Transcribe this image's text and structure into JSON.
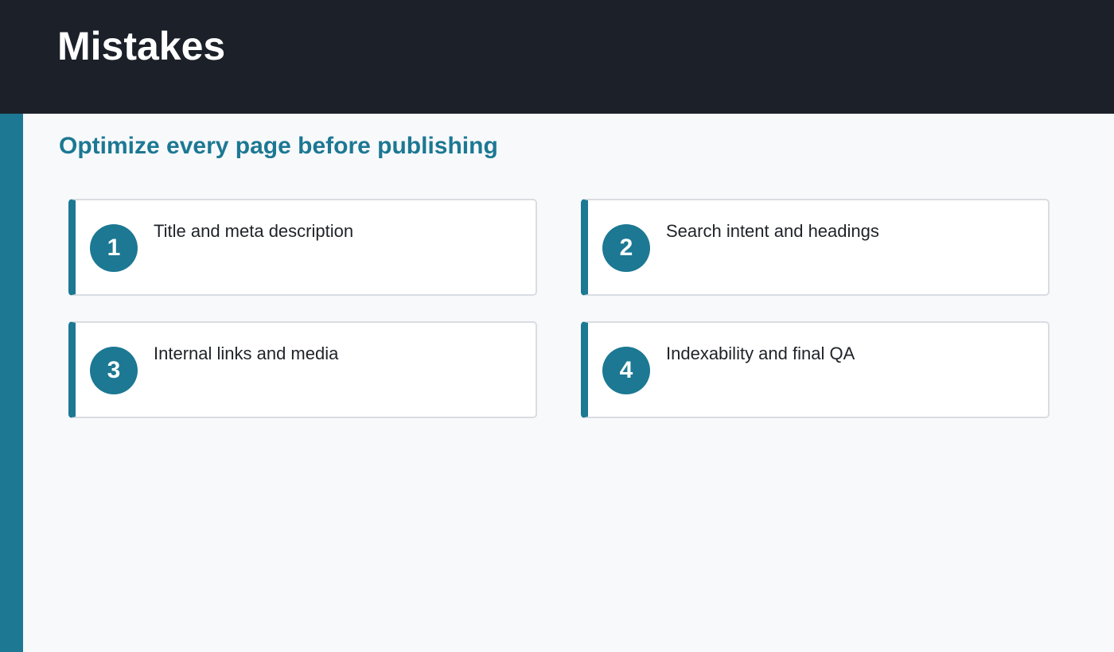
{
  "header": {
    "title": "Mistakes"
  },
  "main": {
    "subtitle": "Optimize every page before publishing",
    "items": [
      {
        "number": "1",
        "label": "Title and meta description"
      },
      {
        "number": "2",
        "label": "Search intent and headings"
      },
      {
        "number": "3",
        "label": "Internal links and media"
      },
      {
        "number": "4",
        "label": "Indexability and final QA"
      }
    ]
  },
  "colors": {
    "header_background": "#1b2029",
    "accent": "#1c7893",
    "page_background": "#f8f9fb",
    "card_border": "#d9dde2"
  }
}
